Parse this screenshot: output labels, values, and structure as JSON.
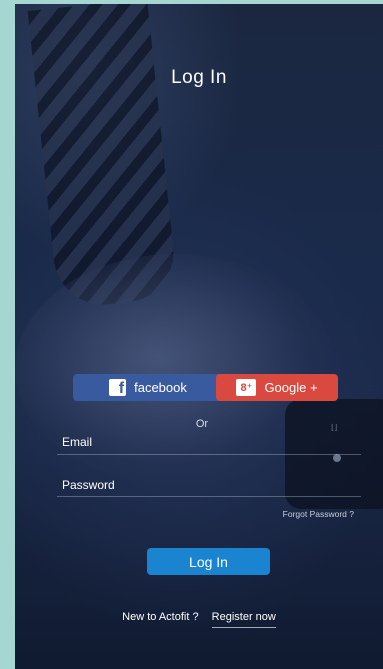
{
  "header": {
    "title": "Log In"
  },
  "social": {
    "facebook_label": "facebook",
    "google_label": "Google +",
    "facebook_color": "#3a5aa0",
    "google_color": "#d9493f"
  },
  "divider": {
    "or_label": "Or"
  },
  "form": {
    "email_label": "Email",
    "password_label": "Password",
    "forgot_label": "Forgot Password ?",
    "login_label": "Log In",
    "login_color": "#1a84d1"
  },
  "footer": {
    "prompt": "New to Actofit  ?",
    "register_label": "Register now"
  },
  "icons": {
    "facebook": "facebook-icon",
    "google": "google-plus-icon"
  }
}
